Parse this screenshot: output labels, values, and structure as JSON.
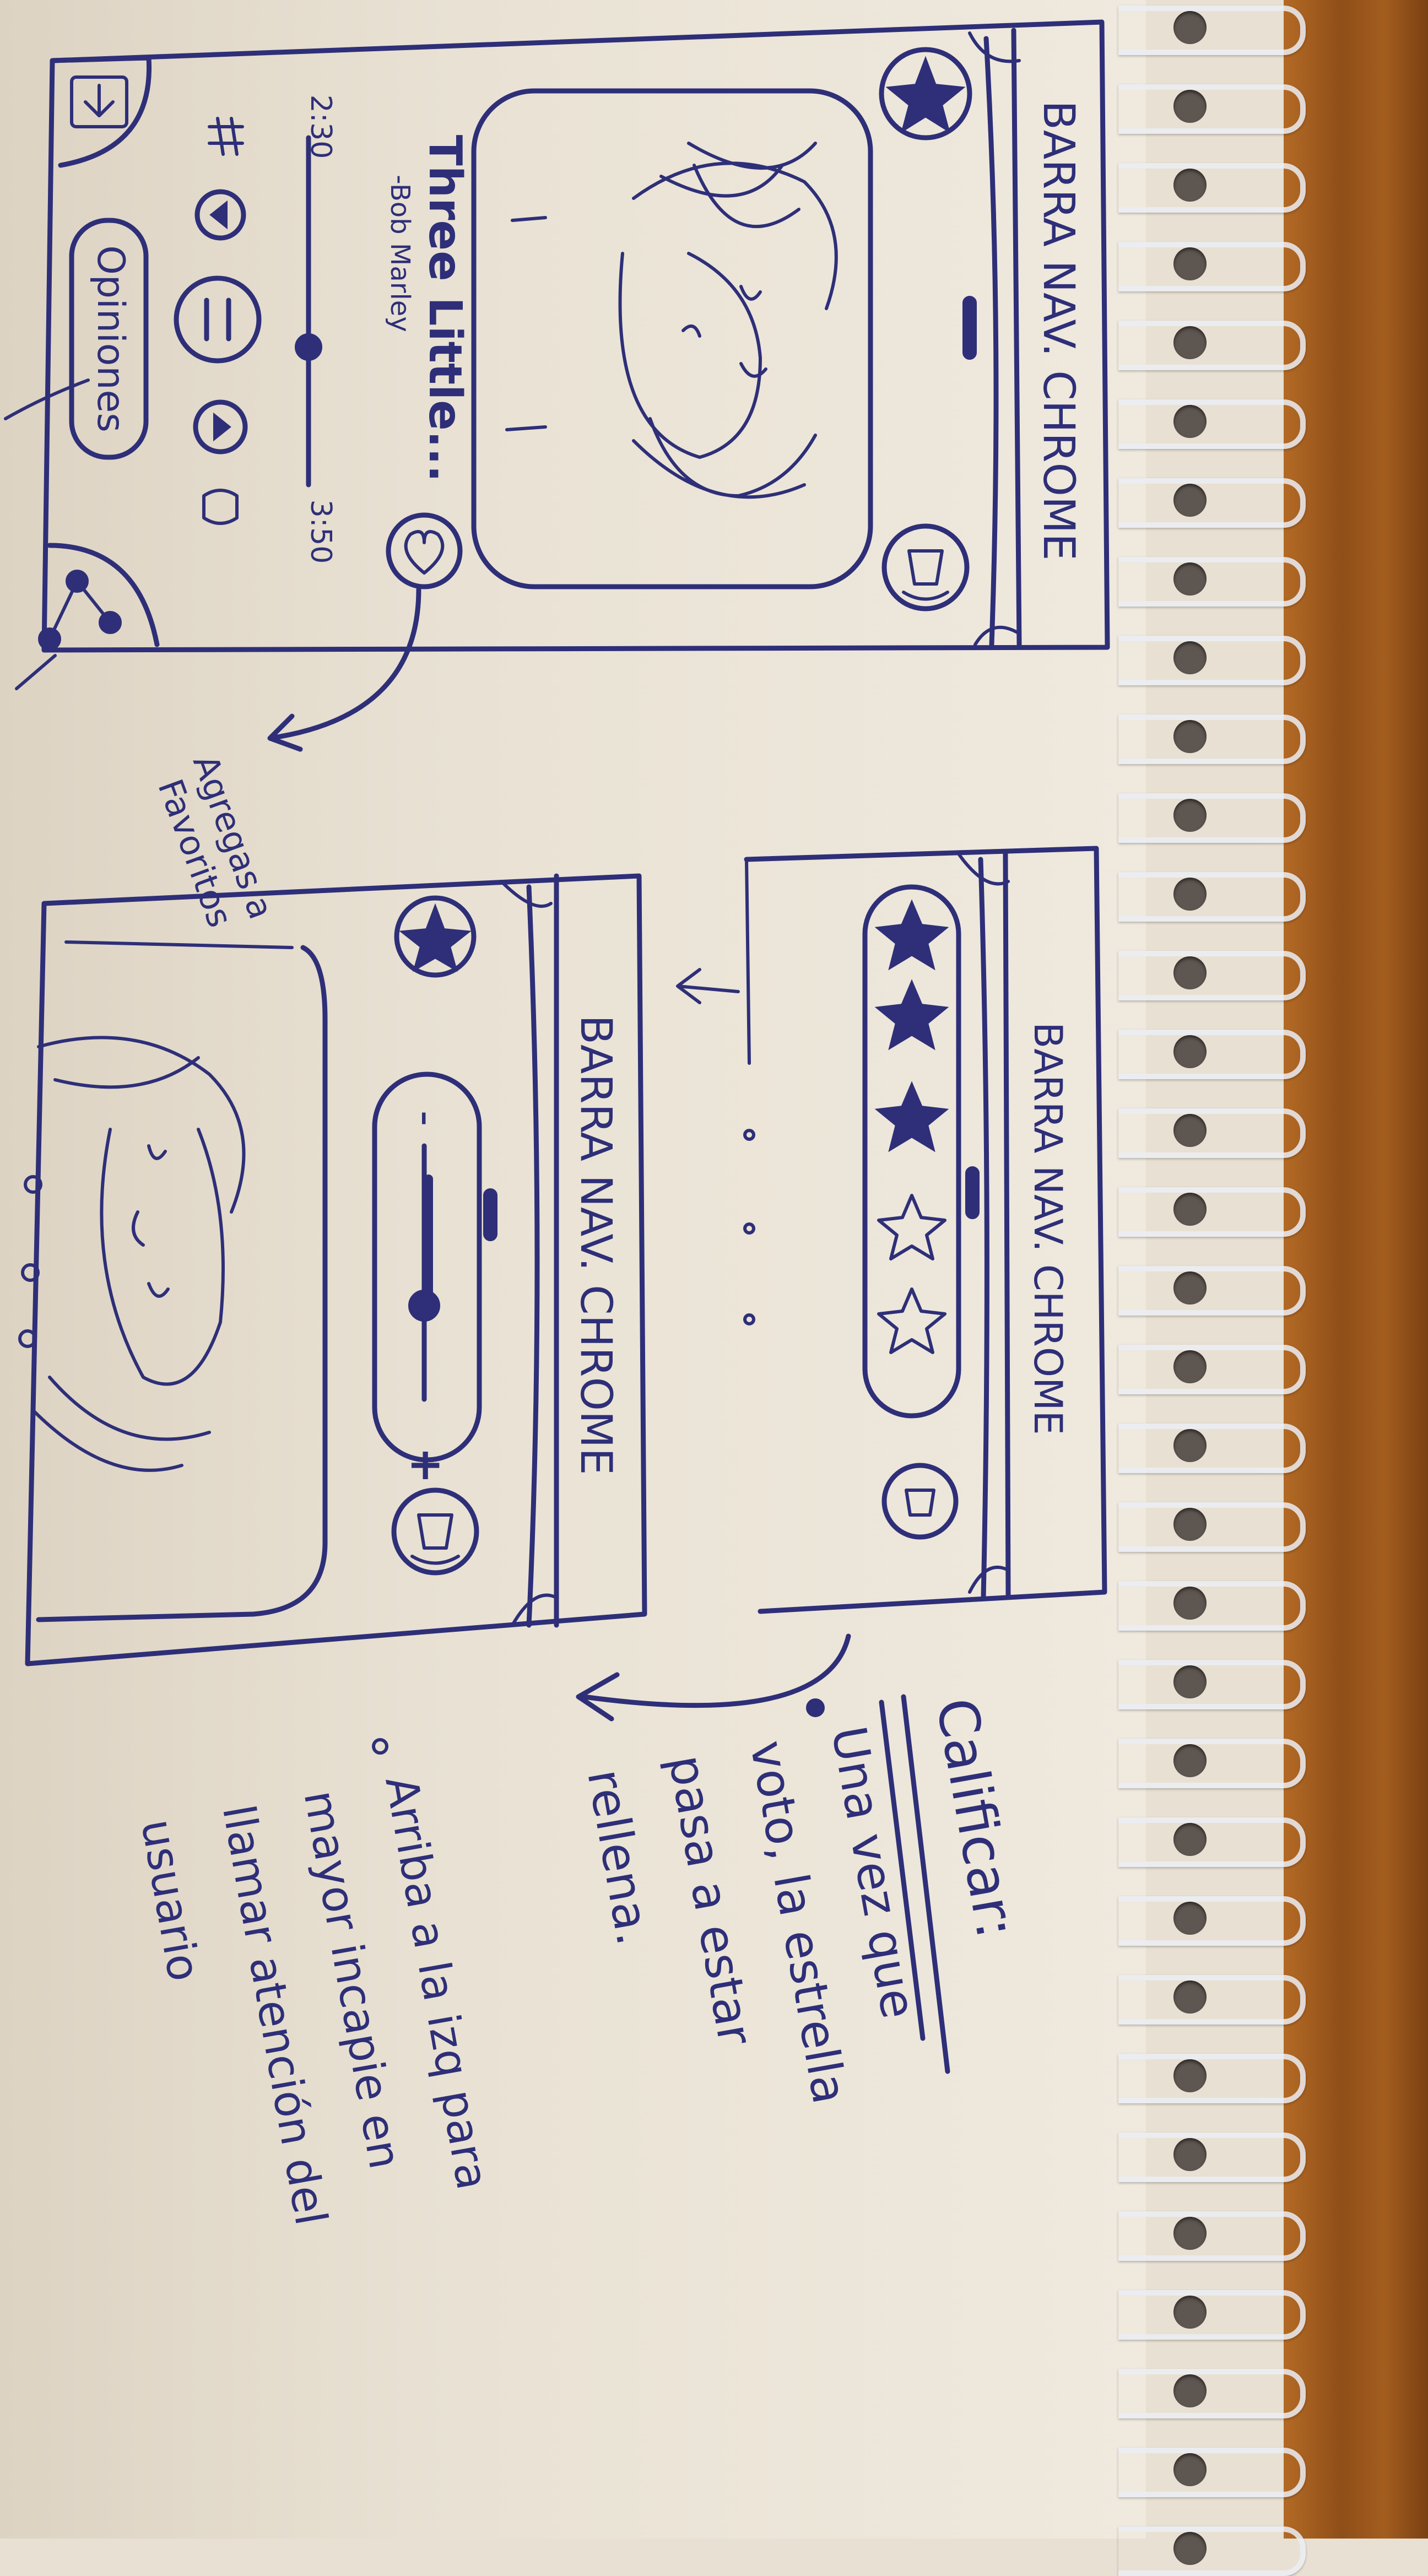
{
  "screen1": {
    "nav_bar": "BARRA NAV. CHROME",
    "song_title": "Three Little...",
    "artist": "-Bob Marley",
    "time_current": "2:30",
    "time_total": "3:50",
    "opinions_button": "Opiniones",
    "favorites_note_line1": "Agregas a",
    "favorites_note_line2": "Favoritos"
  },
  "screen2": {
    "nav_bar": "BARRA NAV. CHROME",
    "stars_filled": 3,
    "stars_total": 5
  },
  "screen3": {
    "nav_bar": "BARRA NAV. CHROME",
    "volume_minus": "-",
    "volume_plus": "+"
  },
  "notes": {
    "heading": "Calificar:",
    "bullet1_lines": [
      "Una vez que",
      "voto, la estrella",
      "pasa a estar",
      "rellena."
    ],
    "bullet2_lines": [
      "Arriba a la izq para",
      "mayor incapie en",
      "llamar atención del",
      "usuario"
    ]
  },
  "colors": {
    "ink": "#2e2f78",
    "paper": "#ebe4d7",
    "desk": "#9a561c"
  }
}
